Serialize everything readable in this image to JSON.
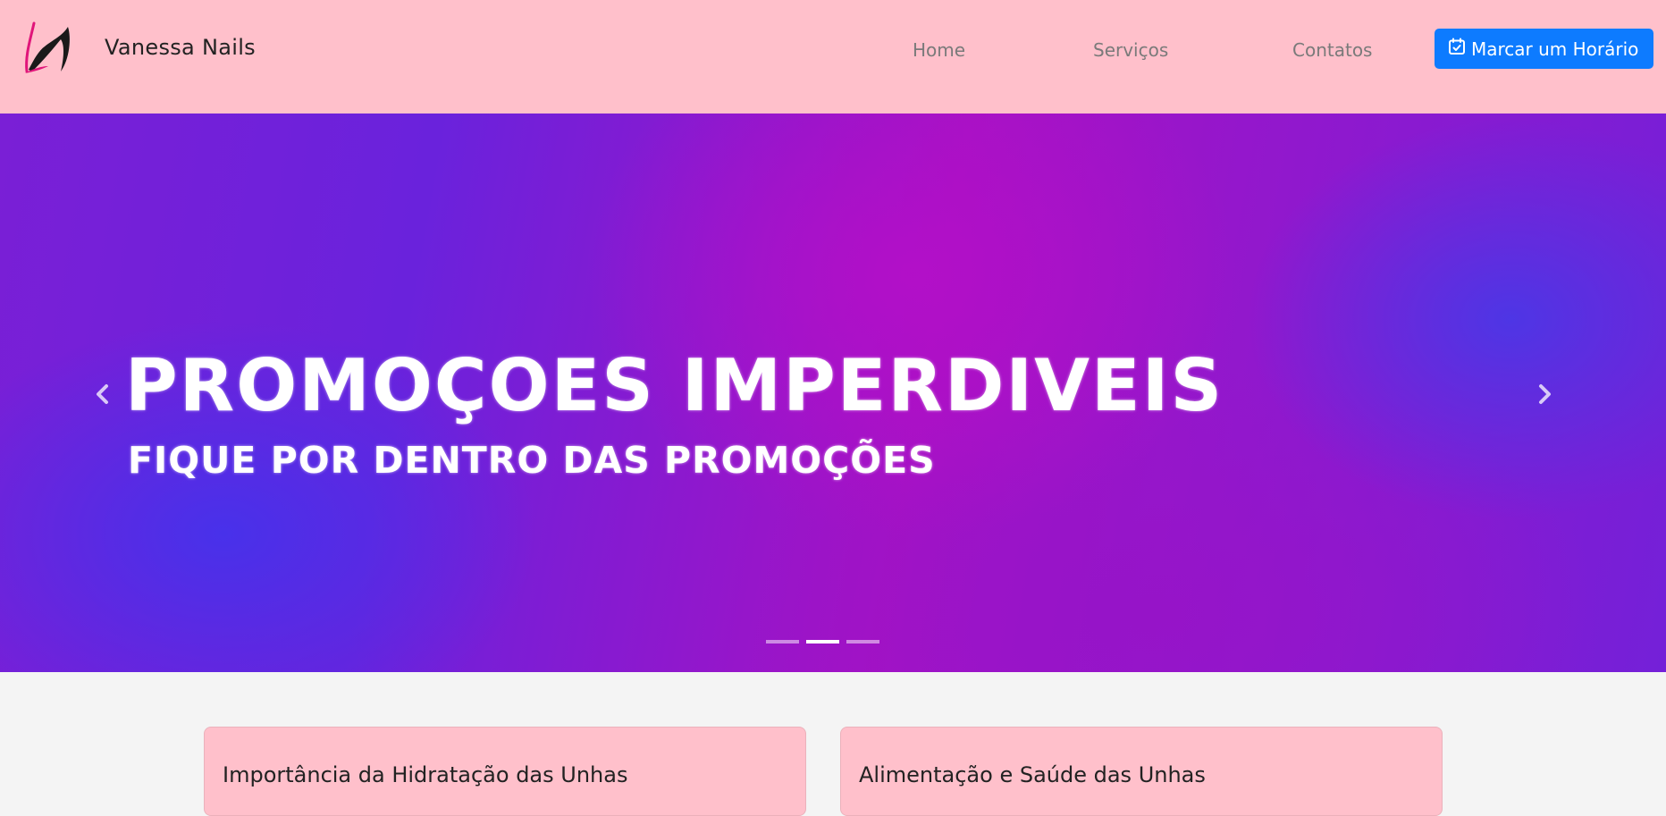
{
  "brand": {
    "name": "Vanessa Nails",
    "logo_icon": "vn-swoosh-logo"
  },
  "nav": {
    "items": [
      {
        "label": "Home"
      },
      {
        "label": "Serviços"
      },
      {
        "label": "Contatos"
      }
    ],
    "cta_label": "Marcar um Horário",
    "cta_icon": "calendar-check-icon",
    "cta_color": "#0d7bff",
    "background": "#ffc0cb"
  },
  "carousel": {
    "title": "PROMOÇOES IMPERDIVEIS",
    "subtitle": "FIQUE POR DENTRO DAS PROMOÇÕES",
    "slide_count": 3,
    "active_index": 1,
    "prev_icon": "chevron-left-icon",
    "next_icon": "chevron-right-icon"
  },
  "cards": [
    {
      "title": "Importância da Hidratação das Unhas"
    },
    {
      "title": "Alimentação e Saúde das Unhas"
    }
  ]
}
